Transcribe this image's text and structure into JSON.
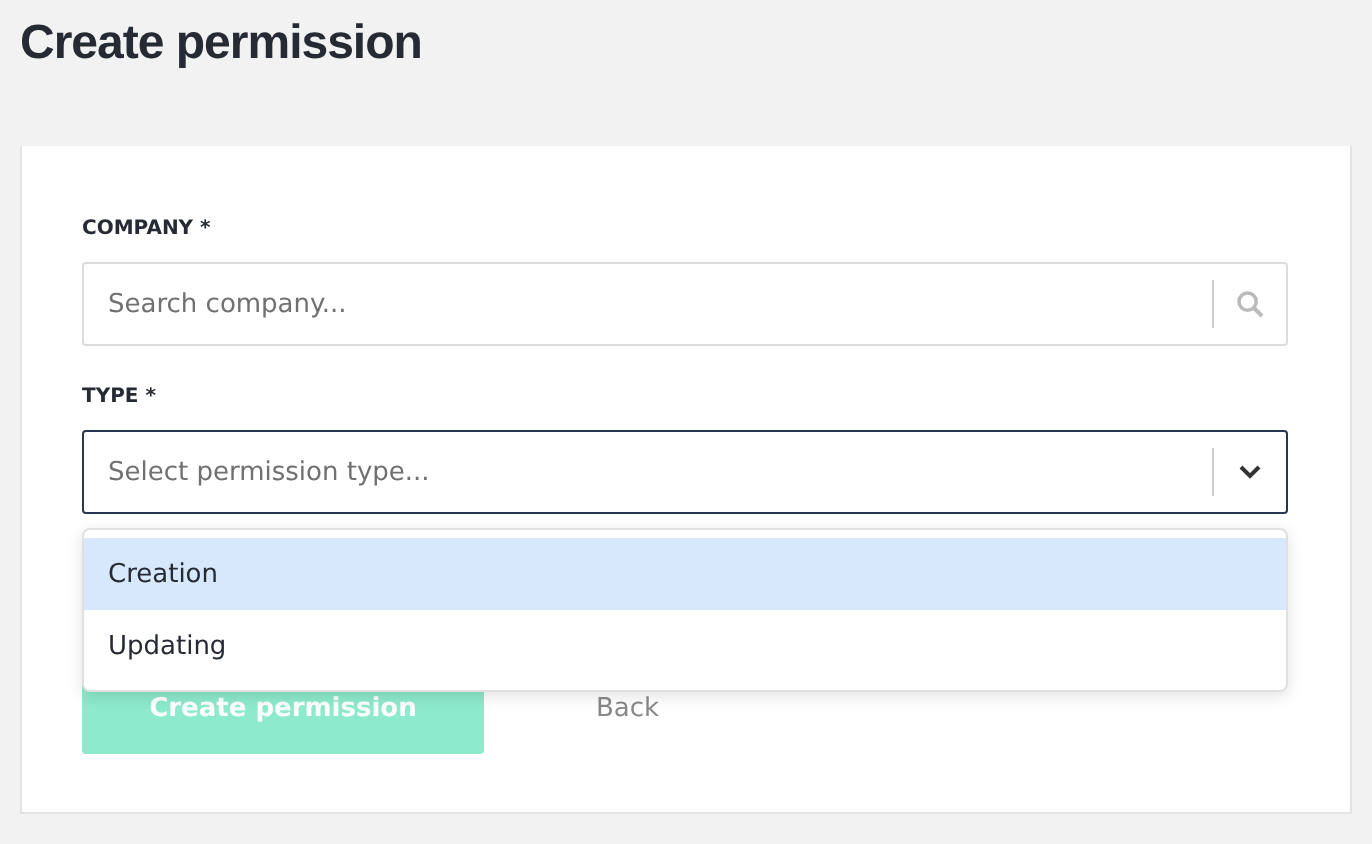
{
  "page": {
    "title": "Create permission"
  },
  "company": {
    "label": "COMPANY *",
    "placeholder": "Search company..."
  },
  "type": {
    "label": "TYPE *",
    "placeholder": "Select permission type...",
    "expanded": true,
    "options": [
      {
        "label": "Creation",
        "selected": true
      },
      {
        "label": "Updating",
        "selected": false
      }
    ]
  },
  "buttons": {
    "submit": {
      "label": "Create permission",
      "disabled": true
    },
    "back": {
      "label": "Back"
    }
  }
}
